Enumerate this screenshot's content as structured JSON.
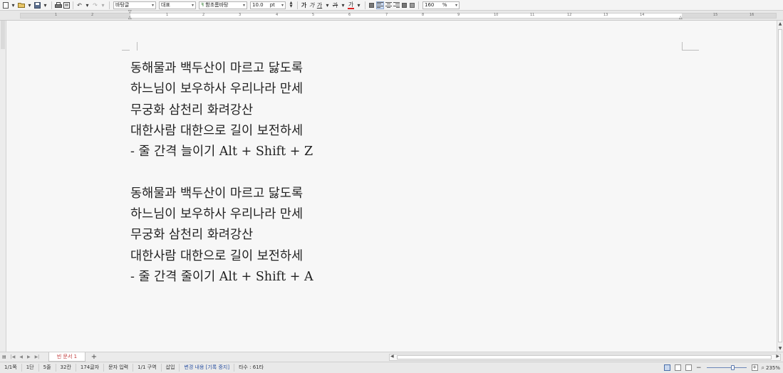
{
  "toolbar": {
    "style_name": "바탕글",
    "font_lang": "대표",
    "font_name": "함초롬바탕",
    "font_size": "10.0",
    "size_unit": "pt",
    "zoom": "160",
    "zoom_unit": "%",
    "bold_label": "가",
    "italic_label": "가",
    "underline_label": "가",
    "strike_label": "가",
    "color_label": "가",
    "accent_color": "#c9d8ee"
  },
  "ruler": {
    "top_numbers": [
      "1",
      "2",
      "1",
      "2",
      "3",
      "4",
      "5",
      "6",
      "7",
      "8",
      "9",
      "10",
      "11",
      "12",
      "13",
      "14",
      "15",
      "16"
    ]
  },
  "document": {
    "lines": [
      "동해물과 백두산이 마르고 닳도록",
      "하느님이 보우하사 우리나라 만세",
      "무궁화 삼천리 화려강산",
      "대한사람 대한으로 길이 보전하세",
      "- 줄 간격 늘이기 Alt + Shift + Z",
      "",
      "동해물과 백두산이 마르고 닳도록",
      "하느님이 보우하사 우리나라 만세",
      "무궁화 삼천리 화려강산",
      "대한사람 대한으로 길이 보전하세",
      "- 줄 간격 줄이기 Alt + Shift + A"
    ]
  },
  "tabs": {
    "doc_tab_label": "빈 문서 1",
    "add_label": "+"
  },
  "status": {
    "page": "1/1쪽",
    "section": "1단",
    "line": "5줄",
    "column": "32칸",
    "chars": "174글자",
    "mode": "문자 입력",
    "region": "1/1 구역",
    "insert": "삽입",
    "track_changes": "변경 내용 [기록 중지]",
    "typing": "타수 : 61타",
    "zoom_value": "235%"
  }
}
